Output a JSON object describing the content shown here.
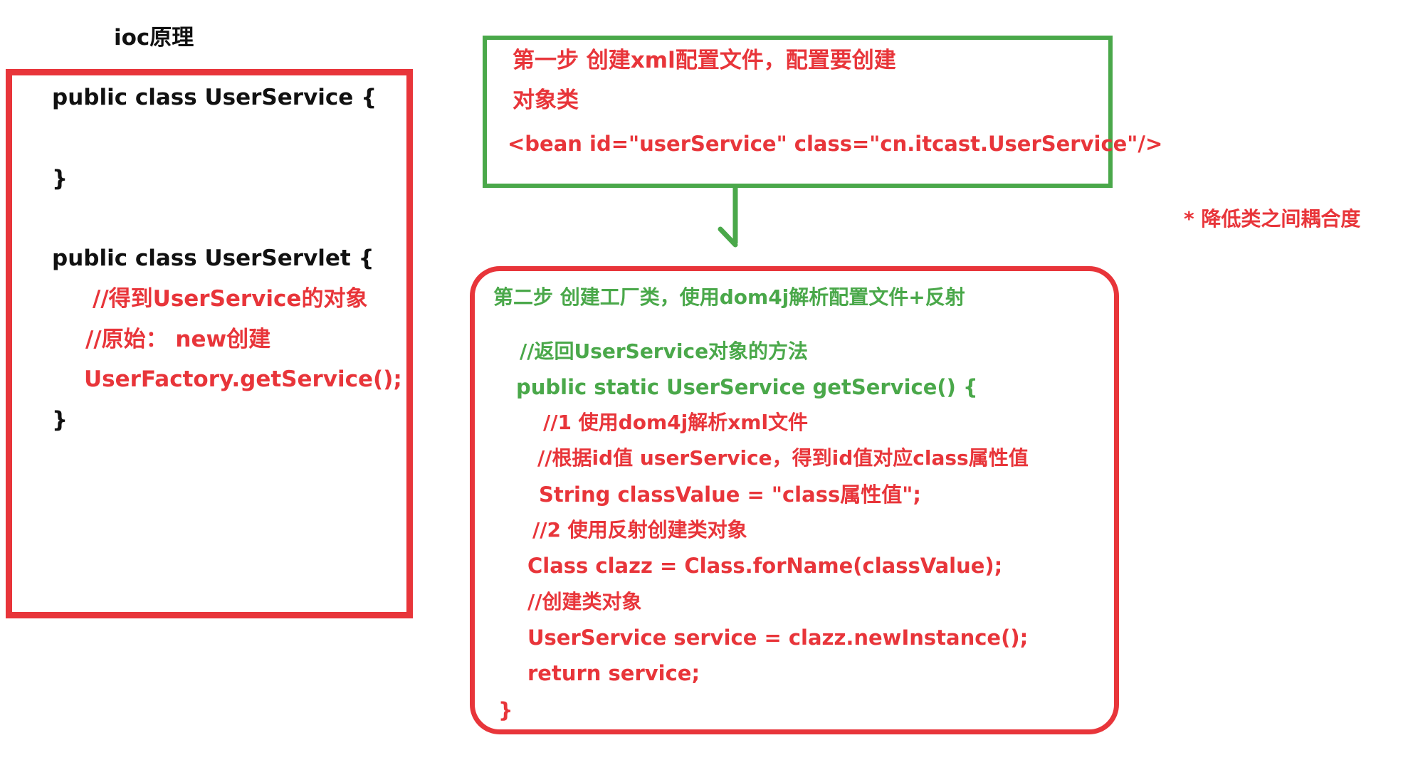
{
  "title": "ioc原理",
  "colors": {
    "red": "#e8353a",
    "green": "#4aa84a",
    "text": "#111111"
  },
  "left_box": {
    "lines": [
      "public class UserService {",
      "}",
      "public class UserServlet {",
      "//得到UserService的对象",
      "//原始：  new创建",
      "UserFactory.getService();",
      "}"
    ]
  },
  "step1_box": {
    "line1": "第一步 创建xml配置文件，配置要创建",
    "line2": "对象类",
    "line3": "<bean id=\"userService\"  class=\"cn.itcast.UserService\"/>"
  },
  "note": "* 降低类之间耦合度",
  "step2_box": {
    "heading": "第二步 创建工厂类，使用dom4j解析配置文件+反射",
    "lines": [
      "//返回UserService对象的方法",
      "public static UserService getService() {",
      "//1 使用dom4j解析xml文件",
      "//根据id值 userService，得到id值对应class属性值",
      "String  classValue = \"class属性值\";",
      "//2 使用反射创建类对象",
      "Class clazz = Class.forName(classValue);",
      "//创建类对象",
      "UserService service = clazz.newInstance();",
      "return service;",
      "}"
    ]
  }
}
